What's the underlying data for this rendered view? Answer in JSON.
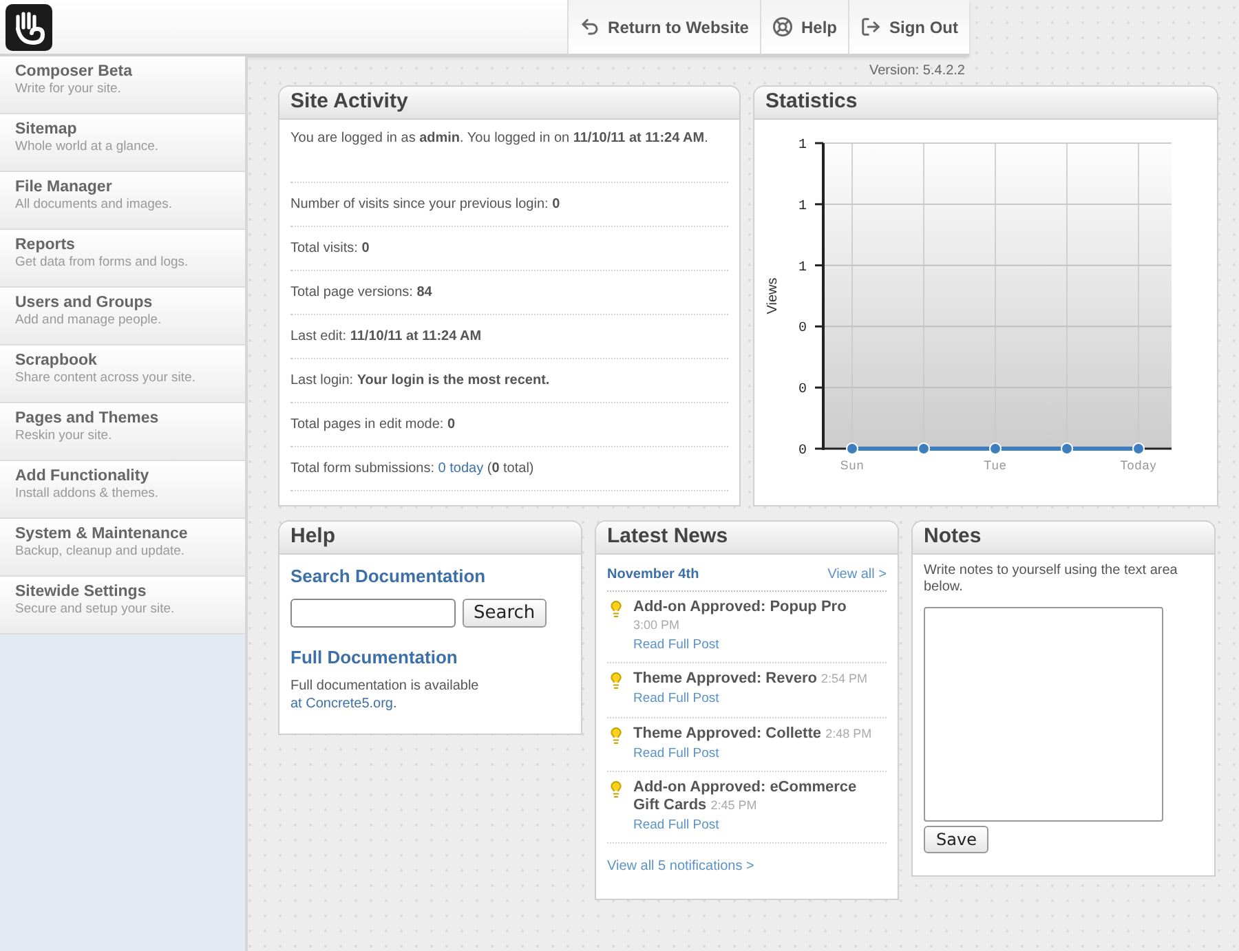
{
  "header": {
    "nav": [
      {
        "label": "Return to Website"
      },
      {
        "label": "Help"
      },
      {
        "label": "Sign Out"
      }
    ],
    "version": "Version: 5.4.2.2"
  },
  "sidebar": {
    "items": [
      {
        "title": "Composer Beta",
        "subtitle": "Write for your site."
      },
      {
        "title": "Sitemap",
        "subtitle": "Whole world at a glance."
      },
      {
        "title": "File Manager",
        "subtitle": "All documents and images."
      },
      {
        "title": "Reports",
        "subtitle": "Get data from forms and logs."
      },
      {
        "title": "Users and Groups",
        "subtitle": "Add and manage people."
      },
      {
        "title": "Scrapbook",
        "subtitle": "Share content across your site."
      },
      {
        "title": "Pages and Themes",
        "subtitle": "Reskin your site."
      },
      {
        "title": "Add Functionality",
        "subtitle": "Install addons & themes."
      },
      {
        "title": "System & Maintenance",
        "subtitle": "Backup, cleanup and update."
      },
      {
        "title": "Sitewide Settings",
        "subtitle": "Secure and setup your site."
      }
    ]
  },
  "site_activity": {
    "title": "Site Activity",
    "rows": [
      {
        "text": "You are logged in as **admin**. You logged in on **11/10/11 at 11:24 AM**."
      },
      {
        "text": "Number of visits since your previous login: **0**"
      },
      {
        "text": "Total visits: **0**"
      },
      {
        "text": "Total page versions: **84**"
      },
      {
        "text": "Last edit: **11/10/11 at 11:24 AM**"
      },
      {
        "text": "Last login: **Your login is the most recent.**"
      },
      {
        "text": "Total pages in edit mode: **0**"
      },
      {
        "text": "Total form submissions: ",
        "link": "0 today",
        "suffix": " (**0** total)"
      }
    ]
  },
  "statistics": {
    "title": "Statistics",
    "chart_data": {
      "type": "line",
      "ylabel": "Views",
      "categories": [
        "Sun",
        null,
        "Tue",
        null,
        "Today"
      ],
      "grid": true,
      "series": [
        {
          "color": "#3d7ebf",
          "marker": "circle",
          "values": [
            0,
            0,
            0,
            0,
            0
          ]
        }
      ],
      "ylim": [
        0,
        1
      ],
      "yticks": [
        {
          "value": 0,
          "label": "0"
        },
        {
          "value": 0.2,
          "label": "0"
        },
        {
          "value": 0.4,
          "label": "0"
        },
        {
          "value": 0.6,
          "label": "1"
        },
        {
          "value": 0.8,
          "label": "1"
        },
        {
          "value": 1,
          "label": "1"
        }
      ]
    }
  },
  "help": {
    "title": "Help",
    "search_heading": "Search Documentation",
    "search_button": "Search",
    "full_heading": "Full Documentation",
    "full_text": "Full documentation is available ",
    "full_link": "at Concrete5.org",
    "full_suffix": "."
  },
  "latest_news": {
    "title": "Latest News",
    "date": "November 4th",
    "view_all": "View all >",
    "items": [
      {
        "title": "Add-on Approved: Popup Pro",
        "time": "3:00 PM",
        "link": "Read Full Post"
      },
      {
        "title": "Theme Approved: Revero",
        "time": "2:54 PM",
        "link": "Read Full Post"
      },
      {
        "title": "Theme Approved: Collette",
        "time": "2:48 PM",
        "link": "Read Full Post"
      },
      {
        "title": "Add-on Approved: eCommerce Gift Cards",
        "time": "2:45 PM",
        "link": "Read Full Post"
      }
    ],
    "footer_link": "View all 5 notifications >"
  },
  "notes": {
    "title": "Notes",
    "text": "Write notes to yourself using the text area below.",
    "save_button": "Save"
  }
}
